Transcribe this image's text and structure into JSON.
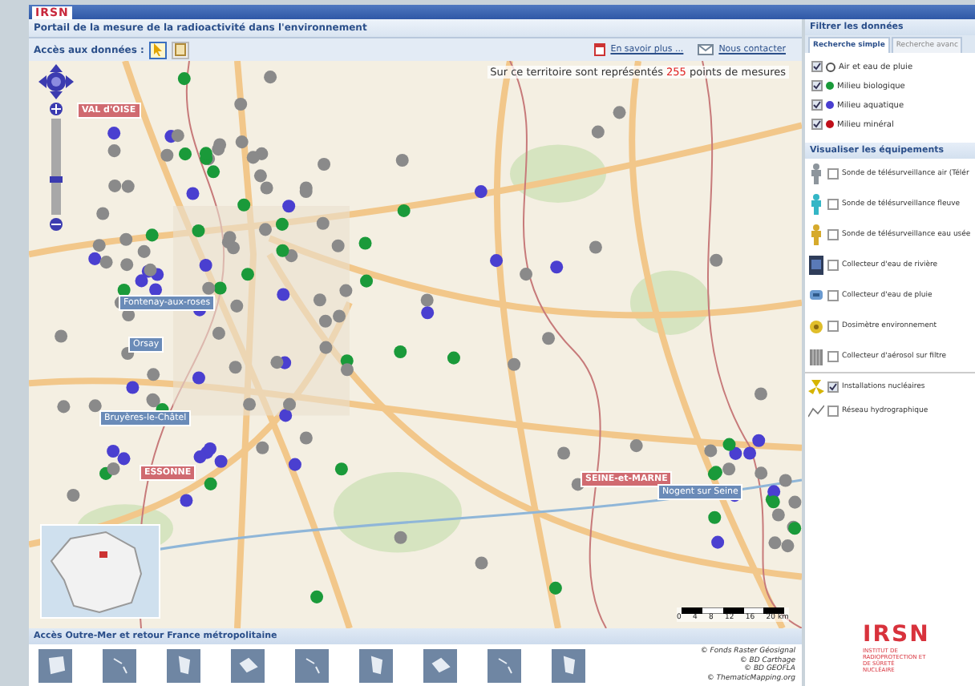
{
  "header": {
    "logo": "IRSN"
  },
  "portal_title": "Portail de la mesure de la radioactivité dans l'environnement",
  "toolbar": {
    "label": "Accès aux données :",
    "tools": [
      {
        "kind": "pointer",
        "selected": true
      },
      {
        "kind": "info",
        "selected": false
      }
    ],
    "links": [
      {
        "kind": "info",
        "label": "En savoir plus ..."
      },
      {
        "kind": "mail",
        "label": "Nous contacter"
      }
    ]
  },
  "map": {
    "summary": {
      "prefix": "Sur ce territoire sont représentés",
      "count": "255",
      "suffix": "points de mesures"
    },
    "labels": [
      {
        "text": "VAL d'OISE",
        "kind": "department"
      },
      {
        "text": "Fontenay-aux-roses",
        "kind": "site"
      },
      {
        "text": "Orsay",
        "kind": "site"
      },
      {
        "text": "Bruyères-le-Châtel",
        "kind": "site"
      },
      {
        "text": "ESSONNE",
        "kind": "department"
      },
      {
        "text": "SEINE-et-MARNE",
        "kind": "department"
      },
      {
        "text": "Nogent sur Seine",
        "kind": "site"
      }
    ],
    "scale": [
      "0",
      "4",
      "8",
      "12",
      "16",
      "20 km"
    ],
    "zoom": {
      "level": 0.35
    }
  },
  "overseas": {
    "title": "Accès Outre-Mer et retour France métropolitaine"
  },
  "credits": [
    "© Fonds Raster Géosignal",
    "© BD Carthage",
    "© BD GEOFLA",
    "© ThematicMapping.org"
  ],
  "filter": {
    "title": "Filtrer les données",
    "tabs": [
      {
        "label": "Recherche simple",
        "selected": true
      },
      {
        "label": "Recherche avanc",
        "selected": false
      }
    ],
    "media": [
      {
        "kind": "air",
        "label": "Air et eau de pluie",
        "checked": true
      },
      {
        "kind": "dot",
        "label": "Milieu biologique",
        "checked": true,
        "color": "#1a9a3a"
      },
      {
        "kind": "dot",
        "label": "Milieu aquatique",
        "checked": true,
        "color": "#4a3fd0"
      },
      {
        "kind": "dot",
        "label": "Milieu minéral",
        "checked": true,
        "color": "#c0101a"
      }
    ]
  },
  "equipment": {
    "title": "Visualiser les équipements",
    "items": [
      {
        "kind": "probe-grey",
        "label": "Sonde de télésurveillance air (Télér",
        "checked": false
      },
      {
        "kind": "probe-cyan",
        "label": "Sonde de télésurveillance fleuve",
        "checked": false
      },
      {
        "kind": "probe-yellow",
        "label": "Sonde de télésurveillance eau usée",
        "checked": false
      },
      {
        "kind": "cabinet",
        "label": "Collecteur d'eau de rivière",
        "checked": false
      },
      {
        "kind": "rain",
        "label": "Collecteur d'eau de pluie",
        "checked": false
      },
      {
        "kind": "dosimeter",
        "label": "Dosimètre environnement",
        "checked": false
      },
      {
        "kind": "filter",
        "label": "Collecteur d'aérosol sur filtre",
        "checked": false
      }
    ],
    "layers": [
      {
        "kind": "nuclear",
        "label": "Installations nucléaires",
        "checked": true
      },
      {
        "kind": "river",
        "label": "Réseau hydrographique",
        "checked": false
      }
    ]
  },
  "logo": {
    "name": "IRSN",
    "subtitle": "INSTITUT DE RADIOPROTECTION ET DE SÛRETÉ NUCLÉAIRE"
  }
}
